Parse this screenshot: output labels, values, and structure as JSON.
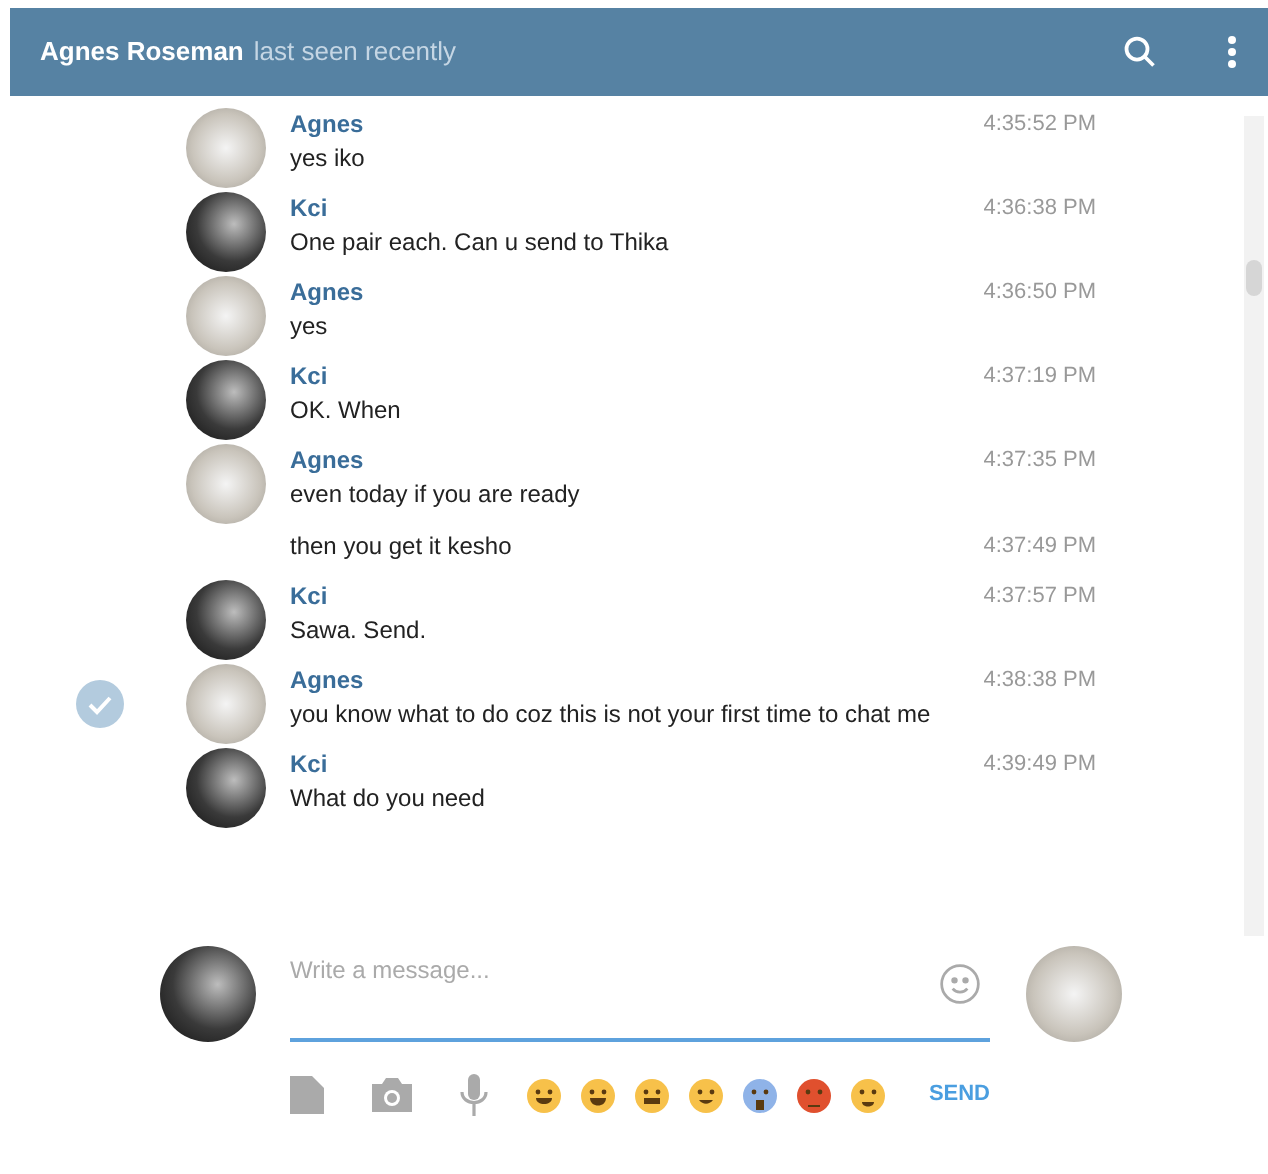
{
  "header": {
    "title": "Agnes Roseman",
    "status": "last seen recently"
  },
  "messages": [
    {
      "kind": "full",
      "outgoing": false,
      "name": "Agnes",
      "time": "4:35:52 PM",
      "text": "yes iko",
      "selected": false
    },
    {
      "kind": "full",
      "outgoing": true,
      "name": "Kci",
      "time": "4:36:38 PM",
      "text": "One pair each. Can u send to Thika",
      "selected": false
    },
    {
      "kind": "full",
      "outgoing": false,
      "name": "Agnes",
      "time": "4:36:50 PM",
      "text": "yes",
      "selected": false
    },
    {
      "kind": "full",
      "outgoing": true,
      "name": "Kci",
      "time": "4:37:19 PM",
      "text": "OK. When",
      "selected": false
    },
    {
      "kind": "full",
      "outgoing": false,
      "name": "Agnes",
      "time": "4:37:35 PM",
      "text": "even today if you are ready",
      "selected": false
    },
    {
      "kind": "continuation",
      "time": "4:37:49 PM",
      "text": "then you get it kesho",
      "selected": false
    },
    {
      "kind": "full",
      "outgoing": true,
      "name": "Kci",
      "time": "4:37:57 PM",
      "text": "Sawa. Send.",
      "selected": false
    },
    {
      "kind": "full",
      "outgoing": false,
      "name": "Agnes",
      "time": "4:38:38 PM",
      "text": "you know what to do coz this is not your first time to chat me",
      "selected": true
    },
    {
      "kind": "full",
      "outgoing": true,
      "name": "Kci",
      "time": "4:39:49 PM",
      "text": "What do you need",
      "selected": false
    }
  ],
  "composer": {
    "placeholder": "Write a message...",
    "send": "SEND"
  }
}
